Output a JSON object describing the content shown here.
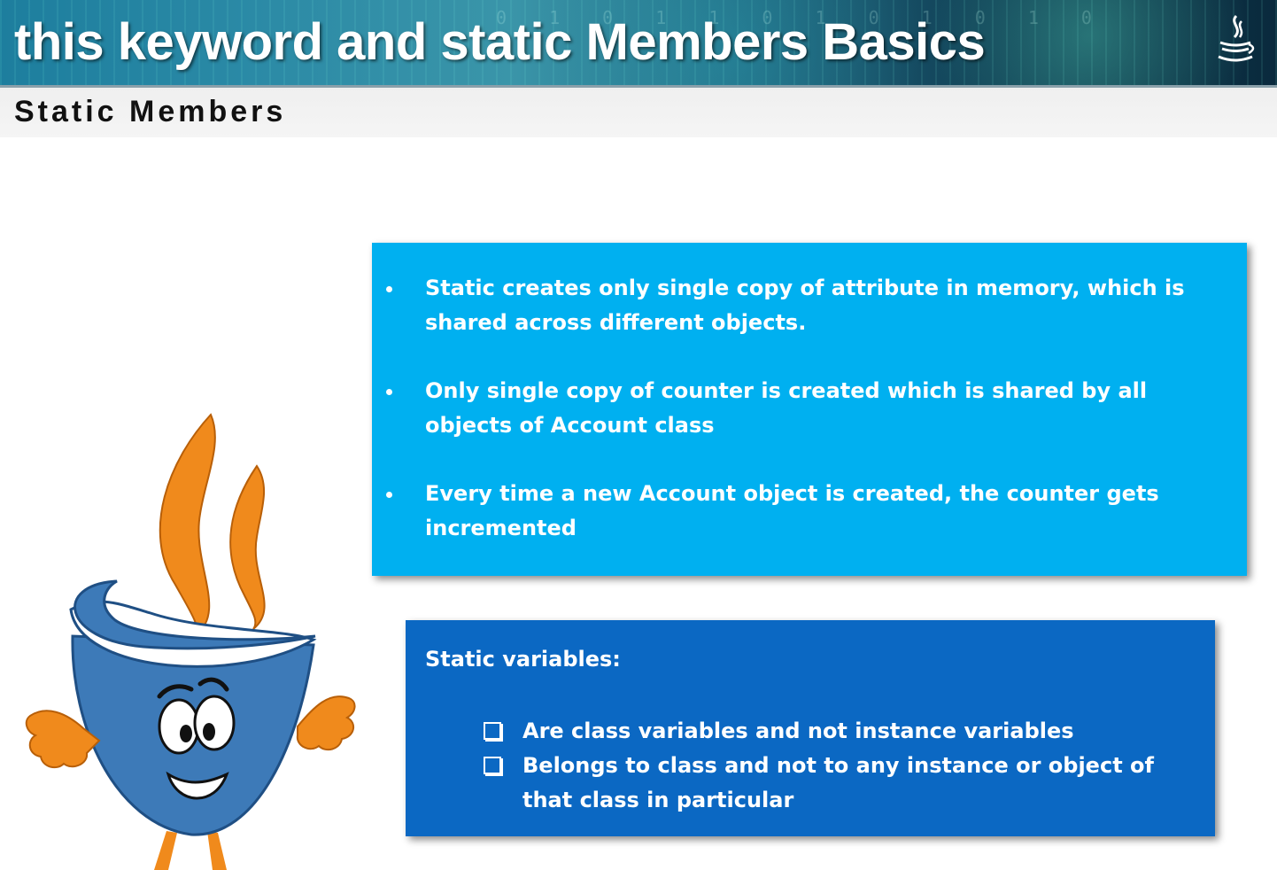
{
  "header": {
    "title": "this keyword and static Members Basics",
    "decoration_digits": "0 1 0 1 1 0 1 0 1 0 1 0"
  },
  "section": {
    "title": "Static Members"
  },
  "info_box": {
    "items": [
      "Static creates only single copy of attribute in memory, which is shared across different objects.",
      "Only single copy of counter is created which is shared by all objects of Account class",
      "Every time a new Account object is created, the counter gets incremented"
    ]
  },
  "static_box": {
    "heading": "Static variables:",
    "items": [
      "Are class variables and not instance variables",
      "Belongs to class and not to any instance or object of that class in particular"
    ]
  },
  "icons": [
    "java-logo-icon",
    "bullet-icon",
    "checkbox-icon",
    "coffee-cup-mascot"
  ],
  "colors": {
    "info_box_bg": "#00b0f0",
    "static_box_bg": "#0b68c3",
    "mascot_blue": "#3d7ab8",
    "mascot_orange": "#f08a1c"
  }
}
